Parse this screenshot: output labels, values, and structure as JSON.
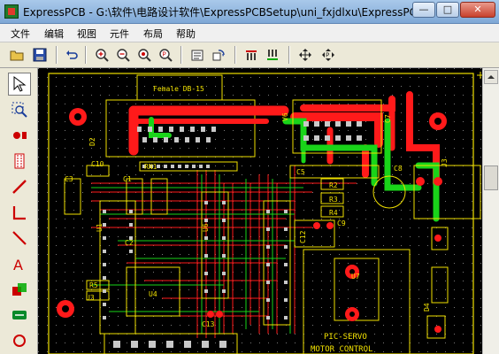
{
  "window": {
    "title": "ExpressPCB - G:\\软件\\电路设计软件\\ExpressPCBSetup\\uni_fxjdlxu\\ExpressPCB",
    "minimize_glyph": "—",
    "maximize_glyph": "□",
    "close_glyph": "✕"
  },
  "menu": {
    "items": [
      "文件",
      "编辑",
      "视图",
      "元件",
      "布局",
      "帮助"
    ]
  },
  "toolbar": {
    "buttons": [
      "open-icon",
      "save-icon",
      "undo-icon",
      "zoom-in-icon",
      "zoom-out-icon",
      "zoom-area-icon",
      "zoom-fit-icon",
      "component-properties-icon",
      "component-rotate-icon",
      "top-layer-icon",
      "bottom-layer-icon",
      "pan-icon",
      "pan-center-icon"
    ]
  },
  "tools": {
    "buttons": [
      "pointer-tool-icon",
      "zoom-select-tool-icon",
      "pad-tool-icon",
      "component-tool-icon",
      "trace-tool-icon",
      "line-tool-icon",
      "diagonal-trace-icon",
      "text-tool-icon",
      "layers-tool-icon",
      "fill-tool-icon",
      "circle-tool-icon"
    ]
  },
  "pcb": {
    "colors": {
      "top_trace": "#ff1a1a",
      "bottom_trace": "#19d419",
      "silkscreen": "#f0e000",
      "pad": "#c8c8c8",
      "background": "#000000"
    },
    "labels": {
      "connector": "Female DB-15",
      "d2": "D2",
      "v6": "V6",
      "rn1": "RN1",
      "c10": "C10",
      "c3": "C3",
      "c1": "C1",
      "c5": "C5",
      "c7": "C7",
      "c8": "C8",
      "j3": "J3",
      "r2": "R2",
      "r3": "R3",
      "r4": "R4",
      "c12": "C12",
      "c9": "C9",
      "c2": "C2",
      "u1": "U1",
      "u4": "U4",
      "u6": "U6",
      "u7": "U7",
      "c13": "C13",
      "r5": "R5",
      "d4": "D4",
      "u3": "U3",
      "board_text1": "PIC-SERVO",
      "board_text2": "MOTOR CONTROL"
    }
  }
}
